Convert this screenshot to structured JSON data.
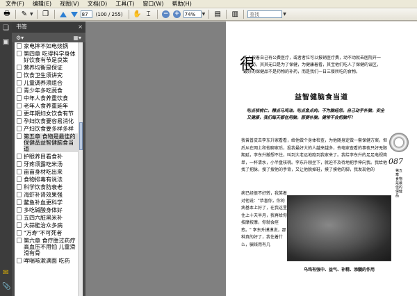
{
  "menu": [
    "文件(F)",
    "编辑(E)",
    "视图(V)",
    "文档(D)",
    "工具(T)",
    "窗口(W)",
    "帮助(H)"
  ],
  "toolbar": {
    "page_current": "87",
    "page_count": "(100 / 255)",
    "zoom": "74%",
    "search_placeholder": "查找"
  },
  "bookmarks_panel": {
    "title": "书签",
    "close": "×",
    "items": [
      {
        "label": "家电摔不如电烧锅"
      },
      {
        "label": "第四章 吃得科学身体好饮食有节是良策"
      },
      {
        "label": "营养均衡是保证"
      },
      {
        "label": "饮食卫生须讲究"
      },
      {
        "label": "儿童调养须组合"
      },
      {
        "label": "青少年多吃蔬食"
      },
      {
        "label": "中年人食养重饮食"
      },
      {
        "label": "老年人食养重延年"
      },
      {
        "label": "更年期妇女饮食有节"
      },
      {
        "label": "孕妇饮食要容易消化"
      },
      {
        "label": "产妇饮食要多样多样"
      },
      {
        "label": "第五章 食物是最佳的保健品益智健脑食当道",
        "selected": true
      },
      {
        "label": "护眼养目看食补"
      },
      {
        "label": "牙疼须露吃米汤"
      },
      {
        "label": "亩亩身材吃出来"
      },
      {
        "label": "食物排毒有说法"
      },
      {
        "label": "科学饮食防衰老"
      },
      {
        "label": "海虾补肾效果强"
      },
      {
        "label": "鳖鱼补血更科学"
      },
      {
        "label": "多吃碱酸身体好"
      },
      {
        "label": "五四六脏黑米补"
      },
      {
        "label": "大蒜能治众多病"
      },
      {
        "label": "\"万寿\"不可死者"
      },
      {
        "label": "第六章 食疗胜过药疗高血压不用怕 儿童滑滑有骨"
      },
      {
        "label": "哮喘咳漱满面 吃药"
      }
    ]
  },
  "document": {
    "big_char": "很",
    "intro": "多人按着自己有公费医疗，或者者位可以报销医疗费，动不动就去医院开一堆补药，其其无口是为了保健，为健康着看，其宝他们吃人了保健的误区，最好的保健品不是药物的补药，而是我们一日三餐所吃的食物。",
    "heading": "益智健脑食当道",
    "motto": "吃点核桃仁，精点马鸡油，吃点鱼点肉，不为脑经怨，自己动手补脑，安全又健康，我们每天都在用脑，那要补脑，健常不会把脑坏！",
    "body1": "我曾普皮去李东升家看看，给他做个身体检查，为他随身定做一套保健方案，但后从在网上和他聊家后，投我最好大的人越来越多，去电家查看的事夜只好无限期延，李东升搬想不住，叫到大老远地跑到我家来了。我给李东升的足足电视简单，一杯清水，小半盘核桃。李东升刚坐下，就迫不及待地把手伸向我。我给他找了把脉，搜了搜他的手背，又让他脱掉鞋，摸了摸他的脚，我发现他的",
    "body2": "病已经很不好转，我笑着对他说：\"恭喜你，你的病基本上好了，在我这里住上十天半月，我再给你按摩按摩，你就会痊愈。\" 李东升摸摸说，那种真的好了，我住着什么，骗钱用有几",
    "caption": "乌鸡有强中、益气、补精、添髓的作用",
    "side_num": "087",
    "side_vertical": "第五章 食物是最佳的保健品"
  }
}
